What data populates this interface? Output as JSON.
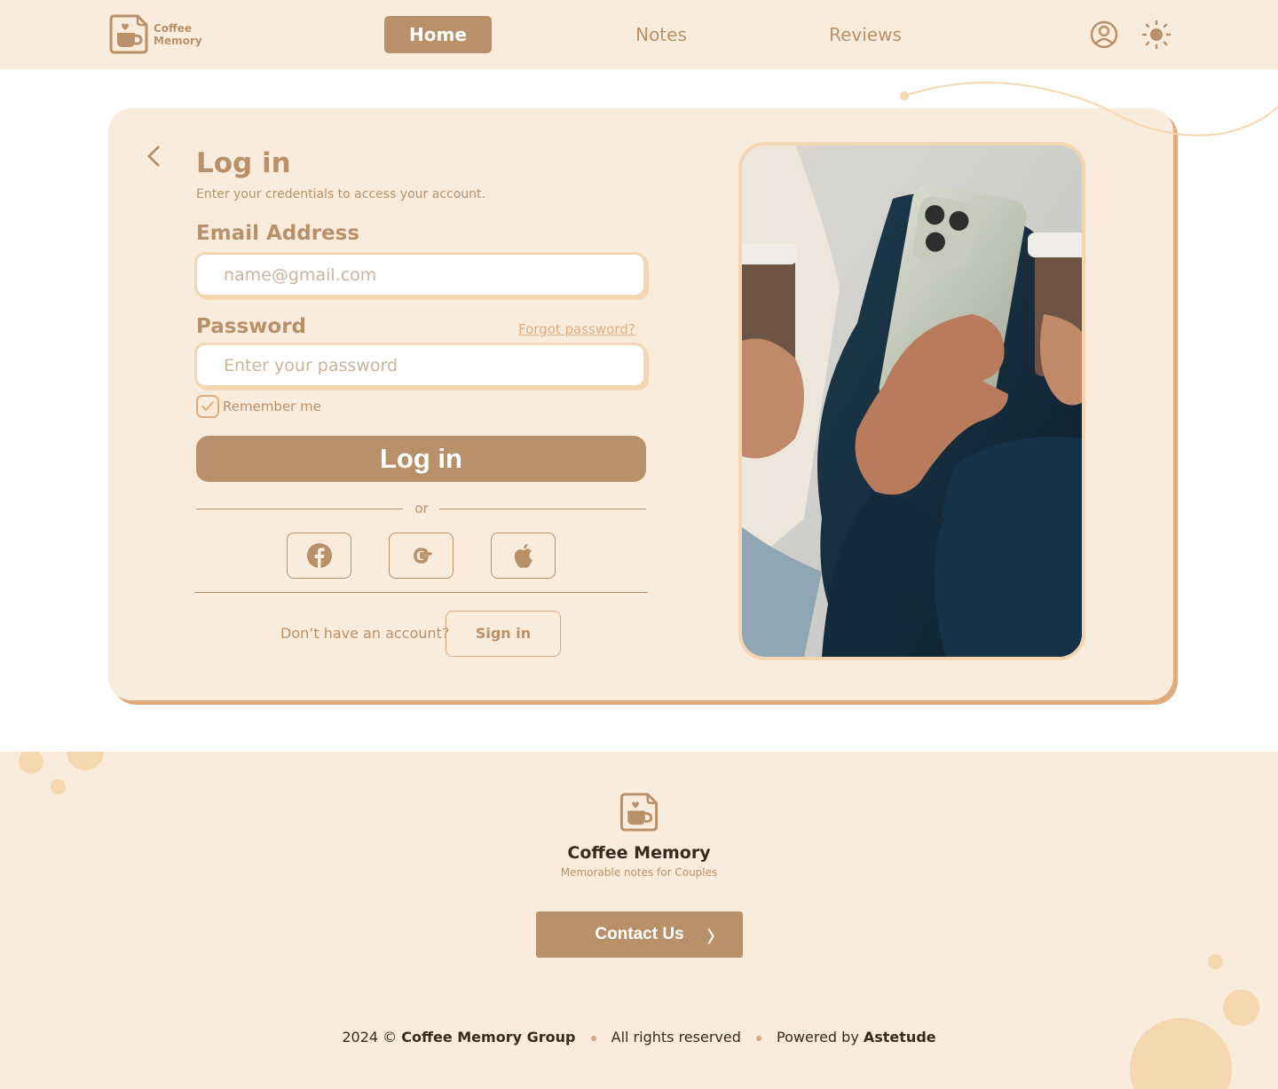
{
  "header": {
    "logo_line1": "Coffee",
    "logo_line2": "Memory",
    "nav": {
      "home": "Home",
      "notes": "Notes",
      "reviews": "Reviews"
    },
    "icons": [
      "user-icon",
      "sun-icon"
    ]
  },
  "login": {
    "title": "Log in",
    "subtitle": "Enter your credentials to access your account.",
    "email_label": "Email Address",
    "email_placeholder": "name@gmail.com",
    "email_value": "",
    "password_label": "Password",
    "password_placeholder": "Enter your password",
    "password_value": "",
    "forgot_label": "Forgot password?",
    "remember_label": "Remember me",
    "remember_checked": true,
    "submit_label": "Log in",
    "or_label": "or",
    "social_icons": [
      "facebook-icon",
      "google-icon",
      "apple-icon"
    ],
    "no_account_text": "Don’t have an account?",
    "signin_label": "Sign in"
  },
  "footer": {
    "title": "Coffee Memory",
    "tagline": "Memorable notes for Couples",
    "contact_label": "Contact Us",
    "contact_chevron": "〉",
    "copyright_year": "2024 ©",
    "company": "Coffee Memory Group",
    "rights": "All rights reserved",
    "powered_by": "Powered by",
    "powered_name": "Astetude"
  },
  "colors": {
    "accent": "#b8916b",
    "background": "#faecdc",
    "border": "#f4d6b3",
    "shadow": "#e0ac7e"
  }
}
